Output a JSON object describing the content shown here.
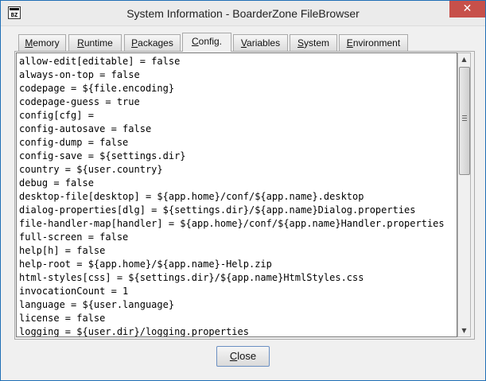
{
  "window": {
    "title": "System Information - BoarderZone FileBrowser",
    "icon": "bz-app-icon",
    "icon_text": "BZ",
    "close_glyph": "✕"
  },
  "tabs": [
    {
      "label": "Memory",
      "mnemonic_index": 0
    },
    {
      "label": "Runtime",
      "mnemonic_index": 0
    },
    {
      "label": "Packages",
      "mnemonic_index": 0
    },
    {
      "label": "Config.",
      "mnemonic_index": 0,
      "active": true
    },
    {
      "label": "Variables",
      "mnemonic_index": 0
    },
    {
      "label": "System",
      "mnemonic_index": 0
    },
    {
      "label": "Environment",
      "mnemonic_index": 0
    }
  ],
  "config_lines": [
    "allow-edit[editable] = false",
    "always-on-top = false",
    "codepage = ${file.encoding}",
    "codepage-guess = true",
    "config[cfg] =",
    "config-autosave = false",
    "config-dump = false",
    "config-save = ${settings.dir}",
    "country = ${user.country}",
    "debug = false",
    "desktop-file[desktop] = ${app.home}/conf/${app.name}.desktop",
    "dialog-properties[dlg] = ${settings.dir}/${app.name}Dialog.properties",
    "file-handler-map[handler] = ${app.home}/conf/${app.name}Handler.properties",
    "full-screen = false",
    "help[h] = false",
    "help-root = ${app.home}/${app.name}-Help.zip",
    "html-styles[css] = ${settings.dir}/${app.name}HtmlStyles.css",
    "invocationCount = 1",
    "language = ${user.language}",
    "license = false",
    "logging = ${user.dir}/logging.properties"
  ],
  "scrollbar": {
    "up_glyph": "▲",
    "down_glyph": "▼",
    "position_fraction": 0.0
  },
  "buttons": {
    "close_label": "Close",
    "close_mnemonic": "C"
  }
}
